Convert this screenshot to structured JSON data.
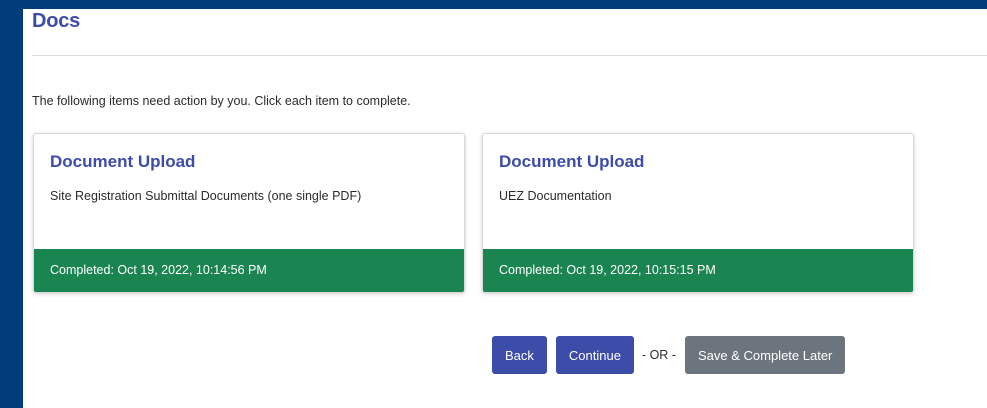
{
  "page": {
    "title": "Docs",
    "intro": "The following items need action by you. Click each item to complete."
  },
  "cards": [
    {
      "title": "Document Upload",
      "description": "Site Registration Submittal Documents (one single PDF)",
      "status": "Completed: Oct 19, 2022, 10:14:56 PM"
    },
    {
      "title": "Document Upload",
      "description": "UEZ Documentation",
      "status": "Completed: Oct 19, 2022, 10:15:15 PM"
    }
  ],
  "actions": {
    "back_label": "Back",
    "continue_label": "Continue",
    "or_label": "- OR -",
    "save_later_label": "Save & Complete Later"
  },
  "colors": {
    "frame_background": "#003d7a",
    "title_color": "#3c4ca8",
    "primary_button": "#3c4ca8",
    "secondary_button": "#6c757d",
    "completed_status": "#1b8552"
  }
}
